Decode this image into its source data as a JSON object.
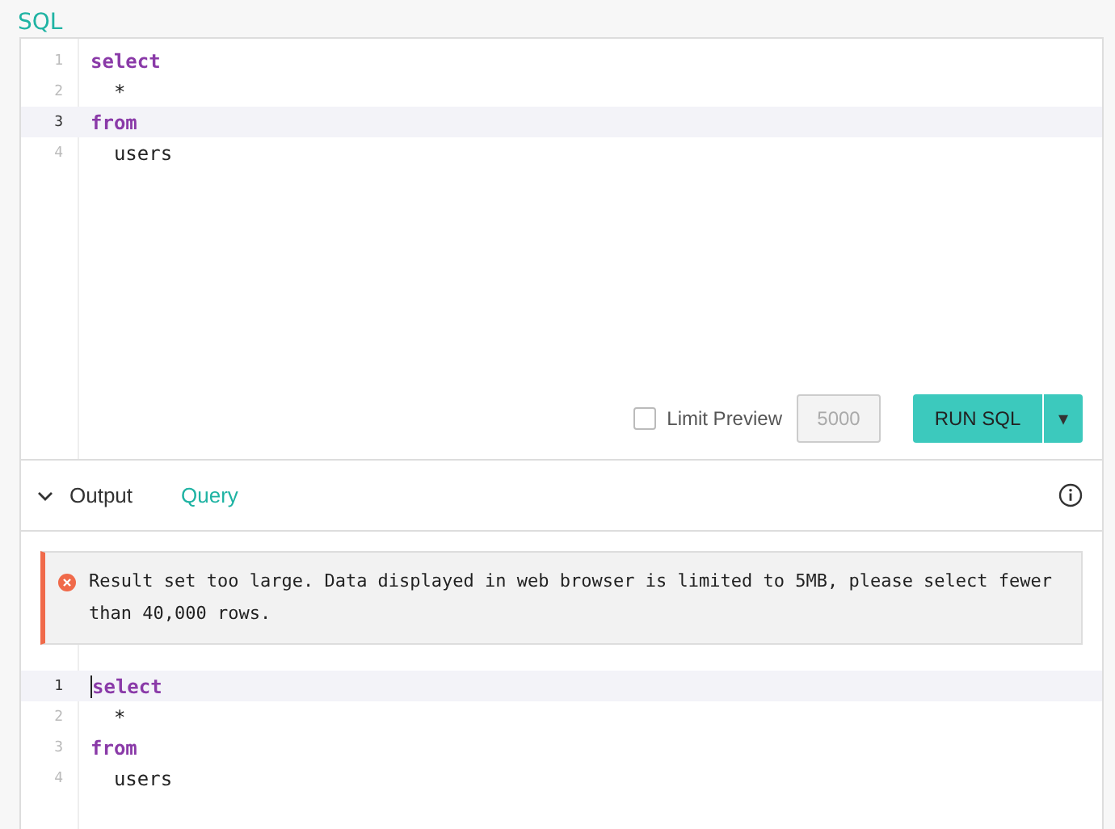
{
  "title": "SQL",
  "editor": {
    "lines": [
      {
        "number": "1",
        "selected": false,
        "tokens": [
          {
            "kind": "keyword",
            "text": "select"
          }
        ]
      },
      {
        "number": "2",
        "selected": false,
        "tokens": [
          {
            "kind": "plain",
            "text": "  *"
          }
        ]
      },
      {
        "number": "3",
        "selected": true,
        "tokens": [
          {
            "kind": "keyword",
            "text": "from"
          }
        ]
      },
      {
        "number": "4",
        "selected": false,
        "tokens": [
          {
            "kind": "plain",
            "text": "  users"
          }
        ]
      }
    ]
  },
  "limit_preview": {
    "label": "Limit Preview",
    "checked": false,
    "value": "5000",
    "disabled": true
  },
  "run_button": {
    "label": "RUN SQL",
    "dropdown": "▾"
  },
  "output_tabs": [
    {
      "label": "Output",
      "selected": false
    },
    {
      "label": "Query",
      "selected": true
    }
  ],
  "error": {
    "message": "Result set too large. Data displayed in web browser is limited to 5MB, please select fewer than 40,000 rows."
  },
  "query_view": {
    "lines": [
      {
        "number": "1",
        "selected": true,
        "tokens": [
          {
            "kind": "keyword",
            "text": "select"
          }
        ]
      },
      {
        "number": "2",
        "selected": false,
        "tokens": [
          {
            "kind": "plain",
            "text": "  *"
          }
        ]
      },
      {
        "number": "3",
        "selected": false,
        "tokens": [
          {
            "kind": "keyword",
            "text": "from"
          }
        ]
      },
      {
        "number": "4",
        "selected": false,
        "tokens": [
          {
            "kind": "plain",
            "text": "  users"
          }
        ]
      }
    ]
  }
}
